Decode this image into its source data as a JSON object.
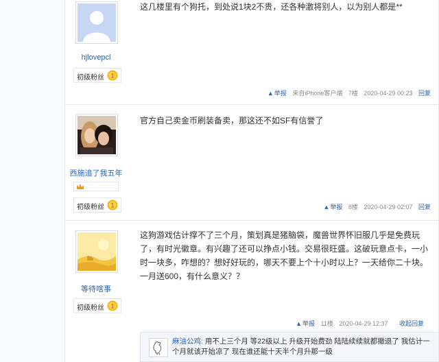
{
  "posts": [
    {
      "username": "hjlovepcl",
      "level": "初级粉丝",
      "content": "这几楼里有个狗托，到处说1块2不贵，还各种激将别人，以为别人都是**",
      "report": "举报",
      "source": "来自iPhone客户端",
      "floor": "7楼",
      "time": "2020-04-29 00:23",
      "reply": "回复"
    },
    {
      "username": "西施追了我五年",
      "level": "初级粉丝",
      "content": "官方自己卖金币刷装备卖，那这还不如SF有信誉了",
      "report": "举报",
      "floor": "8楼",
      "time": "2020-04-29 02:07",
      "reply": "回复"
    },
    {
      "username": "等待啥事",
      "level": "初级粉丝",
      "content": "这狗游戏估计撑不了三个月，策划真是猪脑袋，魔兽世界怀旧服几乎是免费玩了，有时光徽章。有兴趣了还可以挣点小钱。交易很旺盛。这破玩意点卡，一小时一块多，咋想的？想好好玩的，哪天不要上个十小时以上？一天给你二十块。一月送600，有什么意义？？",
      "report": "举报",
      "floor": "11楼",
      "time": "2020-04-29 12:37",
      "collapse": "收起回复"
    }
  ],
  "comment": {
    "user": "麻油公鸡:",
    "text": "用不上三个月 等22级以上 升级开始费劲 陆陆续续就都撤退了 我估计一个月就该开始凉了 现在谁还能十天半个月升那一级"
  }
}
